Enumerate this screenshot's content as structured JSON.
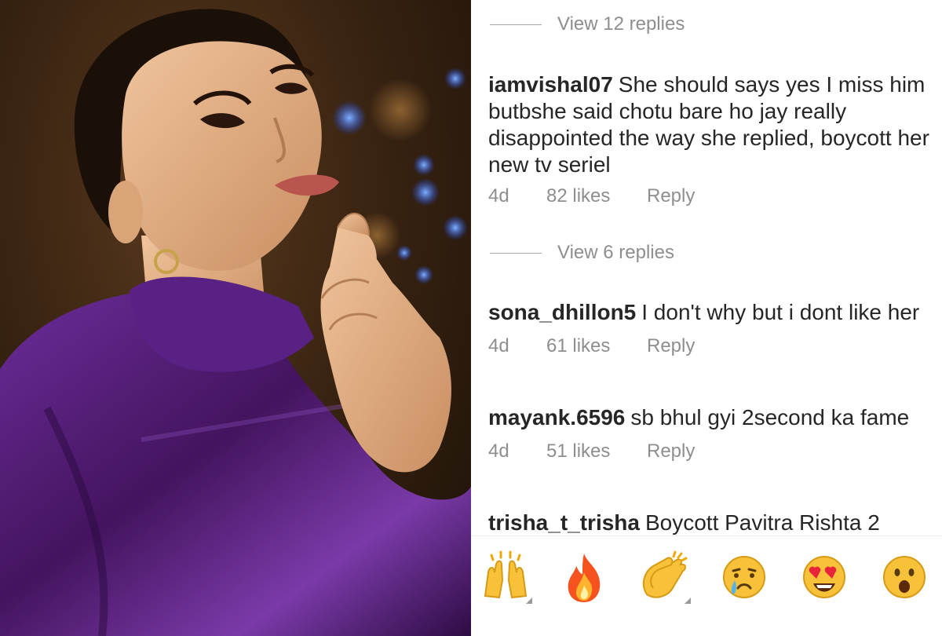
{
  "photo": {
    "alt_subject": "woman-in-purple-satin-blouse"
  },
  "threads": [
    {
      "view_replies_label": "View 12 replies"
    },
    {
      "username": "iamvishal07",
      "text": "She should says yes I miss him butbshe said chotu bare ho jay really disappointed the way she replied, boycott her new tv seriel",
      "time": "4d",
      "likes": "82 likes",
      "reply": "Reply"
    },
    {
      "view_replies_label": "View 6 replies"
    },
    {
      "username": "sona_dhillon5",
      "text": "I don't why but i dont like her",
      "time": "4d",
      "likes": "61 likes",
      "reply": "Reply"
    },
    {
      "username": "mayank.6596",
      "text": "sb bhul gyi 2second ka fame",
      "time": "4d",
      "likes": "51 likes",
      "reply": "Reply"
    },
    {
      "username": "trisha_t_trisha",
      "text": "Boycott Pavitra Rishta 2"
    }
  ],
  "emoji_bar": [
    {
      "icon": "raising-hands-icon"
    },
    {
      "icon": "fire-icon"
    },
    {
      "icon": "clapping-hands-icon"
    },
    {
      "icon": "crying-face-icon"
    },
    {
      "icon": "heart-eyes-icon"
    },
    {
      "icon": "surprised-face-icon"
    }
  ],
  "colors": {
    "username": "#262626",
    "meta_text": "#8e8e8e",
    "blouse_purple": "#4b1a6e",
    "background_brown": "#3a2412"
  }
}
